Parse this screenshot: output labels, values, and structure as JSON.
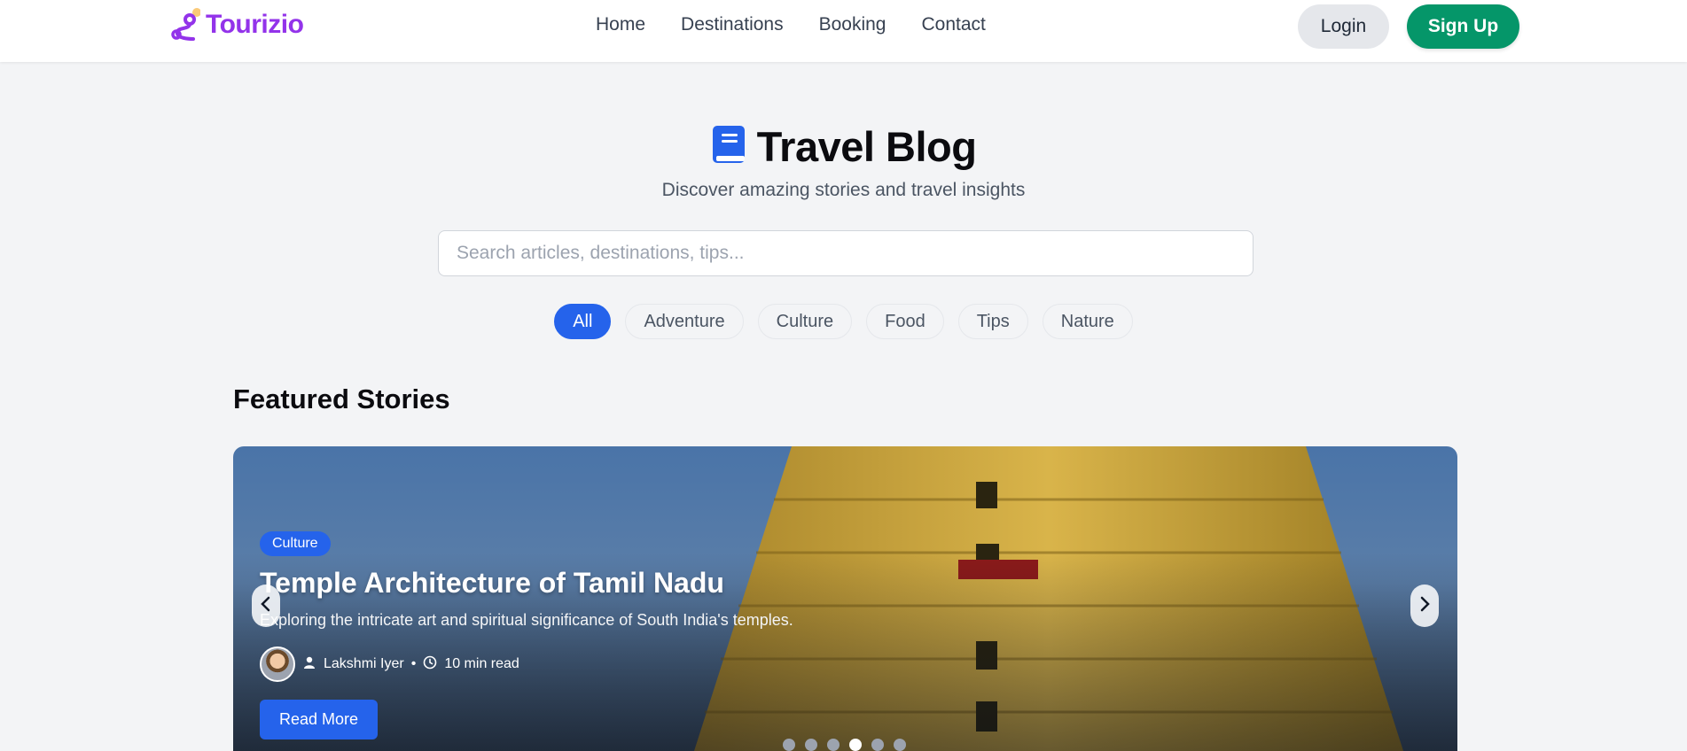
{
  "header": {
    "brand": "Tourizio",
    "nav": [
      "Home",
      "Destinations",
      "Booking",
      "Contact"
    ],
    "login_label": "Login",
    "signup_label": "Sign Up"
  },
  "hero": {
    "title": "Travel Blog",
    "subtitle": "Discover amazing stories and travel insights",
    "search_placeholder": "Search articles, destinations, tips..."
  },
  "filters": {
    "selected": "All",
    "chips": [
      "All",
      "Adventure",
      "Culture",
      "Food",
      "Tips",
      "Nature"
    ]
  },
  "featured": {
    "section_title": "Featured Stories",
    "slide": {
      "category": "Culture",
      "title": "Temple Architecture of Tamil Nadu",
      "description": "Exploring the intricate art and spiritual significance of South India's temples.",
      "author": "Lakshmi Iyer",
      "separator": "•",
      "read_time": "10 min read",
      "cta": "Read More"
    },
    "slides_total": 6,
    "active_slide": 4
  },
  "colors": {
    "brand": "#9333ea",
    "primary": "#2563eb",
    "signup": "#059669"
  }
}
